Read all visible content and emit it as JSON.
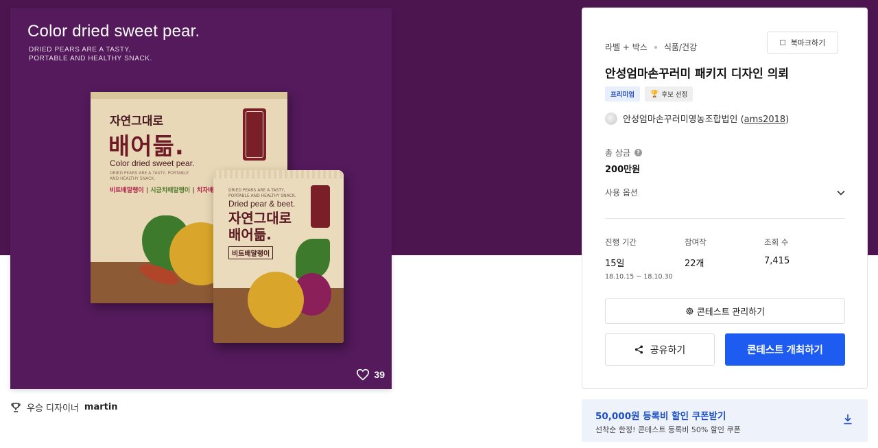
{
  "image": {
    "title": "Color dried sweet pear.",
    "subtitle_line1": "DRIED PEARS ARE A TASTY,",
    "subtitle_line2": "PORTABLE AND HEALTHY SNACK.",
    "box": {
      "ko_small": "자연그대로",
      "ko_big": "배어듦.",
      "en": "Color dried sweet pear.",
      "tiny": "DRIED PEARS ARE A TASTY, PORTABLE AND HEALTHY SNACK.",
      "tag1": "비트배말랭이",
      "tag2": "시금치배말랭이",
      "tag3": "치자배말랭이",
      "sep": " | "
    },
    "pouch": {
      "tiny": "DRIED PEARS ARE A TASTY, PORTABLE AND HEALTHY SNACK.",
      "en": "Dried pear & beet.",
      "ko_line1": "자연그대로",
      "ko_line2": "배어듦.",
      "tag": "비트배말랭이"
    },
    "likes": "39"
  },
  "winner": {
    "label": "우승 디자이너",
    "name": "martin"
  },
  "panel": {
    "category1": "라벨 + 박스",
    "category2": "식품/건강",
    "bookmark_label": "북마크하기",
    "title": "안성엄마손꾸러미 패키지 디자인 의뢰",
    "badge_premium": "프리미엄",
    "badge_candidate": "후보 선정",
    "host_name": "안성엄마손꾸러미영농조합법인",
    "host_paren_open": "(",
    "host_id": "ams2018",
    "host_paren_close": ")",
    "prize_label": "총 상금",
    "prize_value": "200만원",
    "option_label": "사용 옵션",
    "stats": {
      "period_label": "진행 기간",
      "period_value": "15일",
      "period_range": "18.10.15 ~ 18.10.30",
      "entries_label": "참여작",
      "entries_value": "22개",
      "views_label": "조회 수",
      "views_value": "7,415"
    },
    "manage_label": "콘테스트 관리하기",
    "share_label": "공유하기",
    "open_label": "콘테스트 개최하기"
  },
  "coupon": {
    "title": "50,000원 등록비 할인 쿠폰받기",
    "subtitle": "선착순 한정! 콘테스트 등록비 50% 할인 쿠폰"
  },
  "colors": {
    "hero_bg": "#4d1550",
    "primary_button": "#1e5bf0",
    "coupon_bg": "#eef3fb",
    "coupon_text": "#1e4fc8"
  },
  "icons": [
    "heart-icon",
    "trophy-icon",
    "bookmark-icon",
    "help-icon",
    "chevron-down-icon",
    "gear-icon",
    "share-icon",
    "download-icon"
  ]
}
